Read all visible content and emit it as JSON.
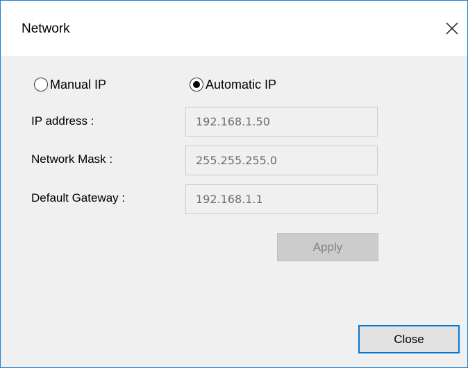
{
  "window": {
    "title": "Network"
  },
  "mode": {
    "manual_label": "Manual IP",
    "automatic_label": "Automatic IP",
    "selected": "automatic"
  },
  "fields": {
    "ip_address": {
      "label": "IP address :",
      "value": "192.168.1.50"
    },
    "network_mask": {
      "label": "Network Mask :",
      "value": "255.255.255.0"
    },
    "default_gateway": {
      "label": "Default Gateway :",
      "value": "192.168.1.1"
    }
  },
  "buttons": {
    "apply_label": "Apply",
    "close_label": "Close"
  },
  "icons": {
    "close": "close-icon"
  },
  "colors": {
    "accent": "#0078d7",
    "window_bg": "#f0f0f0",
    "disabled_text": "#838383"
  }
}
